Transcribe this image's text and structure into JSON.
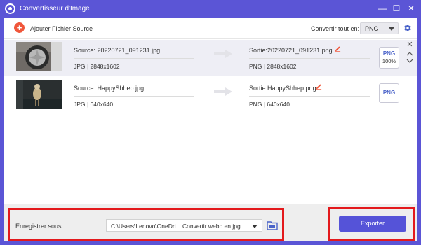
{
  "window": {
    "title": "Convertisseur d'Image",
    "controls": {
      "minimize": "—",
      "maximize": "☐",
      "close": "✕"
    }
  },
  "toolbar": {
    "add_icon": "plus-icon",
    "add_symbol": "+",
    "add_label": "Ajouter Fichier Source",
    "convert_all_label": "Convertir tout en:",
    "convert_all_value": "PNG",
    "settings_icon": "gear-icon"
  },
  "files": [
    {
      "source_label": "Source: 20220721_091231.jpg",
      "source_format": "JPG",
      "source_resolution": "2848x1602",
      "output_label": "Sortie:20220721_091231.png",
      "output_format": "PNG",
      "output_resolution": "2848x1602",
      "target_format": "PNG",
      "quality": "100%",
      "selected": true
    },
    {
      "source_label": "Source: HappyShhep.jpg",
      "source_format": "JPG",
      "source_resolution": "640x640",
      "output_label": "Sortie:HappyShhep.png",
      "output_format": "PNG",
      "output_resolution": "640x640",
      "target_format": "PNG",
      "quality": "",
      "selected": false
    }
  ],
  "bottom": {
    "save_label": "Enregistrer sous:",
    "save_path": "C:\\Users\\Lenovo\\OneDri... Convertir webp en jpg",
    "export_label": "Exporter"
  },
  "colors": {
    "titlebar": "#5b55d6",
    "accent_button": "#5553d8",
    "add_button": "#f0563a",
    "highlight": "#e3191c",
    "edit_icon": "#f0563a",
    "format_text": "#4a63c9"
  }
}
